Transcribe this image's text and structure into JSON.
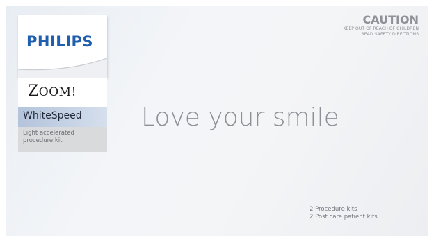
{
  "brand": {
    "company": "PHILIPS",
    "product": "Zoom!",
    "variant": "WhiteSpeed",
    "description": "Light accelerated procedure kit",
    "company_color": "#1f5fae",
    "variant_band_color": "#c7d3e6"
  },
  "headline": "Love your smile",
  "caution": {
    "title": "CAUTION",
    "lines": [
      "KEEP OUT OF REACH OF CHILDREN",
      "READ SAFETY DIRECTIONS"
    ]
  },
  "contents": [
    "2 Procedure kits",
    "2 Post care patient kits"
  ]
}
